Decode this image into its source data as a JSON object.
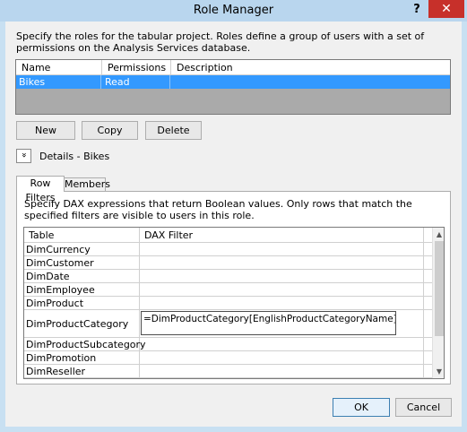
{
  "window": {
    "title": "Role Manager",
    "help_glyph": "?",
    "close_glyph": "✕"
  },
  "intro_text": "Specify the roles for the tabular project. Roles define a group of users with a set of permissions on the Analysis Services database.",
  "roles": {
    "columns": [
      "Name",
      "Permissions",
      "Description"
    ],
    "rows": [
      {
        "name": "Bikes",
        "permissions": "Read",
        "description": ""
      }
    ]
  },
  "buttons": {
    "new": "New",
    "copy": "Copy",
    "delete": "Delete",
    "ok": "OK",
    "cancel": "Cancel"
  },
  "details": {
    "expander_glyph": "»",
    "label": "Details - Bikes"
  },
  "tabs": [
    "Row Filters",
    "Members"
  ],
  "row_filters": {
    "description": "Specify DAX expressions that return Boolean values. Only rows that match the specified filters are visible to users in this role.",
    "columns": [
      "Table",
      "DAX Filter"
    ],
    "rows": [
      {
        "table": "DimCurrency",
        "filter": ""
      },
      {
        "table": "DimCustomer",
        "filter": ""
      },
      {
        "table": "DimDate",
        "filter": ""
      },
      {
        "table": "DimEmployee",
        "filter": ""
      },
      {
        "table": "DimProduct",
        "filter": ""
      },
      {
        "table": "DimProductCategory",
        "filter": "=DimProductCategory[EnglishProductCategoryName] = \"Bikes\""
      },
      {
        "table": "DimProductSubcategory",
        "filter": ""
      },
      {
        "table": "DimPromotion",
        "filter": ""
      },
      {
        "table": "DimReseller",
        "filter": ""
      }
    ]
  },
  "scrollbar": {
    "up_glyph": "▲",
    "down_glyph": "▼"
  },
  "colors": {
    "selection": "#3399ff",
    "close_button": "#c7302a",
    "window_frame": "#b9d6ee"
  }
}
